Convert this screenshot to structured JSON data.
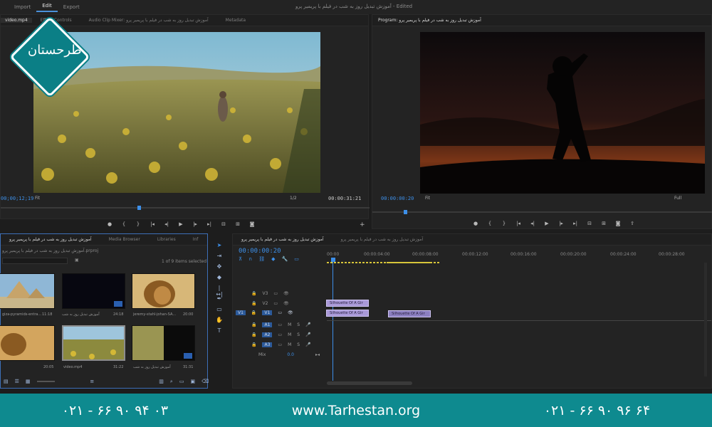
{
  "menu": {
    "items": [
      "Import",
      "Edit",
      "Export"
    ]
  },
  "window": {
    "title": "آموزش تبدیل روز به شب در فیلم با پریمیر پرو - Edited"
  },
  "source": {
    "tabs": [
      "video.mp4",
      "Effect Controls",
      "Audio Clip Mixer: آموزش تبدیل روز به شب در فیلم با پریمیر پرو",
      "Metadata"
    ],
    "timecode_in": "00;00;12;19",
    "timecode_out": "00:00:31:21",
    "fit": "Fit",
    "res": "1/2"
  },
  "program": {
    "title": "Program: آموزش تبدیل روز به شب در فیلم با پریمیر پرو",
    "timecode": "00:00:00:20",
    "fit": "Fit",
    "res": "Full"
  },
  "project": {
    "tabs": [
      "آموزش تبدیل روز به شب در فیلم با پریمیر پرو",
      "Media Browser",
      "Libraries",
      "Inf"
    ],
    "path": "آموزش تبدیل روز به شب در فیلم با پریمیر پرو.prproj",
    "count": "1 of 9 items selected",
    "items": [
      {
        "label": "giza-pyramids-entra...",
        "dur": "11:18"
      },
      {
        "label": "آموزش تبدیل روز به شب",
        "dur": "24:18"
      },
      {
        "label": "jeremy-stahl-johan-SA...",
        "dur": "20:00"
      },
      {
        "label": "",
        "dur": "20:05"
      },
      {
        "label": "video.mp4",
        "dur": "31:22"
      },
      {
        "label": "آموزش تبدیل روز به شب",
        "dur": "31:31"
      }
    ]
  },
  "timeline": {
    "tab": "آموزش تبدیل روز به شب در فیلم با پریمیر پرو",
    "tab2": "آموزش تبدیل روز به شب در فیلم با پریمیر پرو",
    "timecode": "00:00:00:20",
    "ruler": [
      "00:00",
      "00:00:04:00",
      "00:00:08:00",
      "00:00:12:00",
      "00:00:16:00",
      "00:00:20:00",
      "00:00:24:00",
      "00:00:28:00"
    ],
    "tracks": [
      "V3",
      "V2",
      "V1",
      "A1",
      "A2",
      "A3",
      "Mix"
    ],
    "mix_value": "0.0",
    "clips": [
      "Silhouette Of A Gir",
      "Silhouette Of A Gir",
      "Silhouette Of A Gir"
    ]
  },
  "footer": {
    "phone1": "۰۲۱ - ۶۶ ۹۰ ۹۴ ۰۳",
    "site": "www.Tarhestan.org",
    "phone2": "۰۲۱ - ۶۶ ۹۰ ۹۶ ۶۴"
  },
  "logo": {
    "text": "طرحستان"
  },
  "colors": {
    "accent": "#3d8fe8",
    "footer": "#0e8a8f",
    "clip": "#a999d8"
  }
}
